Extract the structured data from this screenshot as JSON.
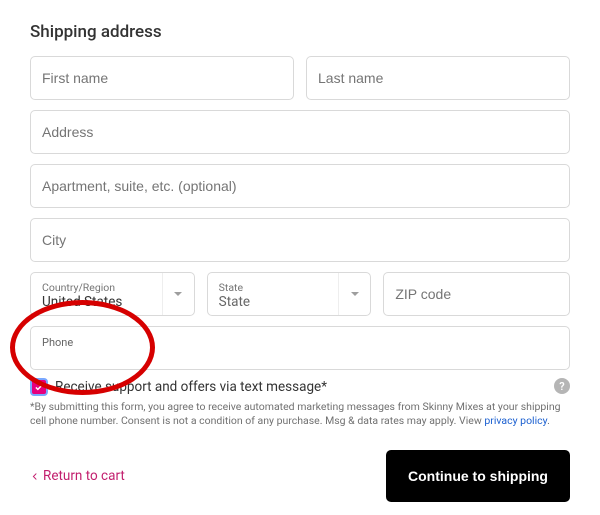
{
  "heading": "Shipping address",
  "fields": {
    "first_name_placeholder": "First name",
    "last_name_placeholder": "Last name",
    "address_placeholder": "Address",
    "apt_placeholder": "Apartment, suite, etc. (optional)",
    "city_placeholder": "City",
    "country_label": "Country/Region",
    "country_value": "United States",
    "state_label": "State",
    "state_value": "State",
    "zip_placeholder": "ZIP code",
    "phone_label": "Phone",
    "phone_value": ""
  },
  "consent": {
    "checked": true,
    "label": "Receive support and offers via text message*",
    "fine_print_prefix": "*By submitting this form, you agree to receive automated marketing messages from Skinny Mixes at your shipping cell phone number. Consent is not a condition of any purchase. Msg & data rates may apply. View ",
    "privacy_link_text": "privacy policy",
    "fine_print_suffix": "."
  },
  "footer": {
    "return_label": "Return to cart",
    "continue_label": "Continue to shipping"
  }
}
